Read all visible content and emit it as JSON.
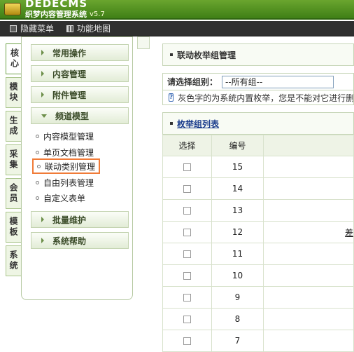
{
  "header": {
    "brand": "DEDECMS",
    "subtitle": "织梦内容管理系统",
    "version": "v5.7"
  },
  "menubar": [
    {
      "label": "隐藏菜单",
      "icon": "hide-menu-icon"
    },
    {
      "label": "功能地图",
      "icon": "map-grid-icon"
    }
  ],
  "side_tabs": [
    "核心",
    "模块",
    "生成",
    "采集",
    "会员",
    "模板",
    "系统"
  ],
  "categories_top": [
    "常用操作",
    "内容管理",
    "附件管理",
    "频道模型"
  ],
  "submenu": [
    "内容模型管理",
    "单页文档管理",
    "联动类别管理",
    "自由列表管理",
    "自定义表单"
  ],
  "categories_bottom": [
    "批量维护",
    "系统帮助"
  ],
  "main": {
    "title": "联动枚举组管理",
    "filter_label": "请选择组别：",
    "filter_value": "--所有组--",
    "note": "灰色字的为系统内置枚举，您是不能对它进行删除的",
    "list_title": "枚举组列表",
    "col_select": "选择",
    "col_id": "编号",
    "rows": [
      "15",
      "14",
      "13",
      "12",
      "11",
      "10",
      "9",
      "8",
      "7"
    ],
    "row12_extra": "差"
  }
}
